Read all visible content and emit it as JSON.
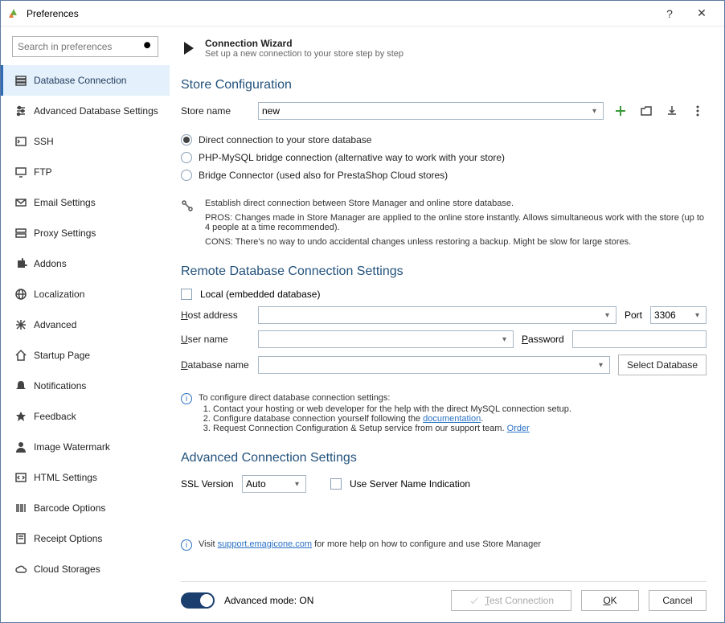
{
  "window": {
    "title": "Preferences"
  },
  "search": {
    "placeholder": "Search in preferences"
  },
  "sidebar": {
    "items": [
      {
        "label": "Database Connection"
      },
      {
        "label": "Advanced Database Settings"
      },
      {
        "label": "SSH"
      },
      {
        "label": "FTP"
      },
      {
        "label": "Email Settings"
      },
      {
        "label": "Proxy Settings"
      },
      {
        "label": "Addons"
      },
      {
        "label": "Localization"
      },
      {
        "label": "Advanced"
      },
      {
        "label": "Startup Page"
      },
      {
        "label": "Notifications"
      },
      {
        "label": "Feedback"
      },
      {
        "label": "Image Watermark"
      },
      {
        "label": "HTML Settings"
      },
      {
        "label": "Barcode Options"
      },
      {
        "label": "Receipt Options"
      },
      {
        "label": "Cloud Storages"
      }
    ]
  },
  "wizard": {
    "title": "Connection Wizard",
    "subtitle": "Set up a new connection to your store step by step"
  },
  "store_config": {
    "heading": "Store Configuration",
    "store_name_label": "Store name",
    "store_name_value": "new",
    "radios": {
      "direct": "Direct connection to your store database",
      "bridge": "PHP-MySQL bridge connection (alternative way to work with your store)",
      "connector": "Bridge Connector (used also for PrestaShop Cloud stores)"
    },
    "desc_main": "Establish direct connection between Store Manager and online store database.",
    "pros": "PROS: Changes made in Store Manager are applied to the online store instantly. Allows simultaneous work with the store (up to 4 people at a time recommended).",
    "cons": "CONS: There's no way to undo accidental changes unless restoring a backup. Might be slow for large stores."
  },
  "remote": {
    "heading": "Remote Database Connection Settings",
    "local_chk": "Local (embedded database)",
    "host_label": "Host address",
    "port_label": "Port",
    "port_value": "3306",
    "user_label": "User name",
    "pass_label": "Password",
    "dbname_label": "Database name",
    "select_db_btn": "Select Database",
    "info_lead": "To configure direct database connection settings:",
    "step1": "Contact your hosting or web developer for the help with the direct MySQL connection setup.",
    "step2a": "Configure database connection yourself following the ",
    "step2_link": "documentation",
    "step2b": ".",
    "step3a": "Request Connection Configuration & Setup service from our support team. ",
    "step3_link": "Order"
  },
  "advanced": {
    "heading": "Advanced Connection Settings",
    "ssl_label": "SSL Version",
    "ssl_value": "Auto",
    "sni_label": "Use Server Name Indication"
  },
  "support": {
    "pre": "Visit ",
    "link": "support.emagicone.com",
    "post": " for more help on how to configure and use Store Manager"
  },
  "footer": {
    "adv_mode": "Advanced mode: ON",
    "test": "Test Connection",
    "ok": "OK",
    "cancel": "Cancel"
  }
}
